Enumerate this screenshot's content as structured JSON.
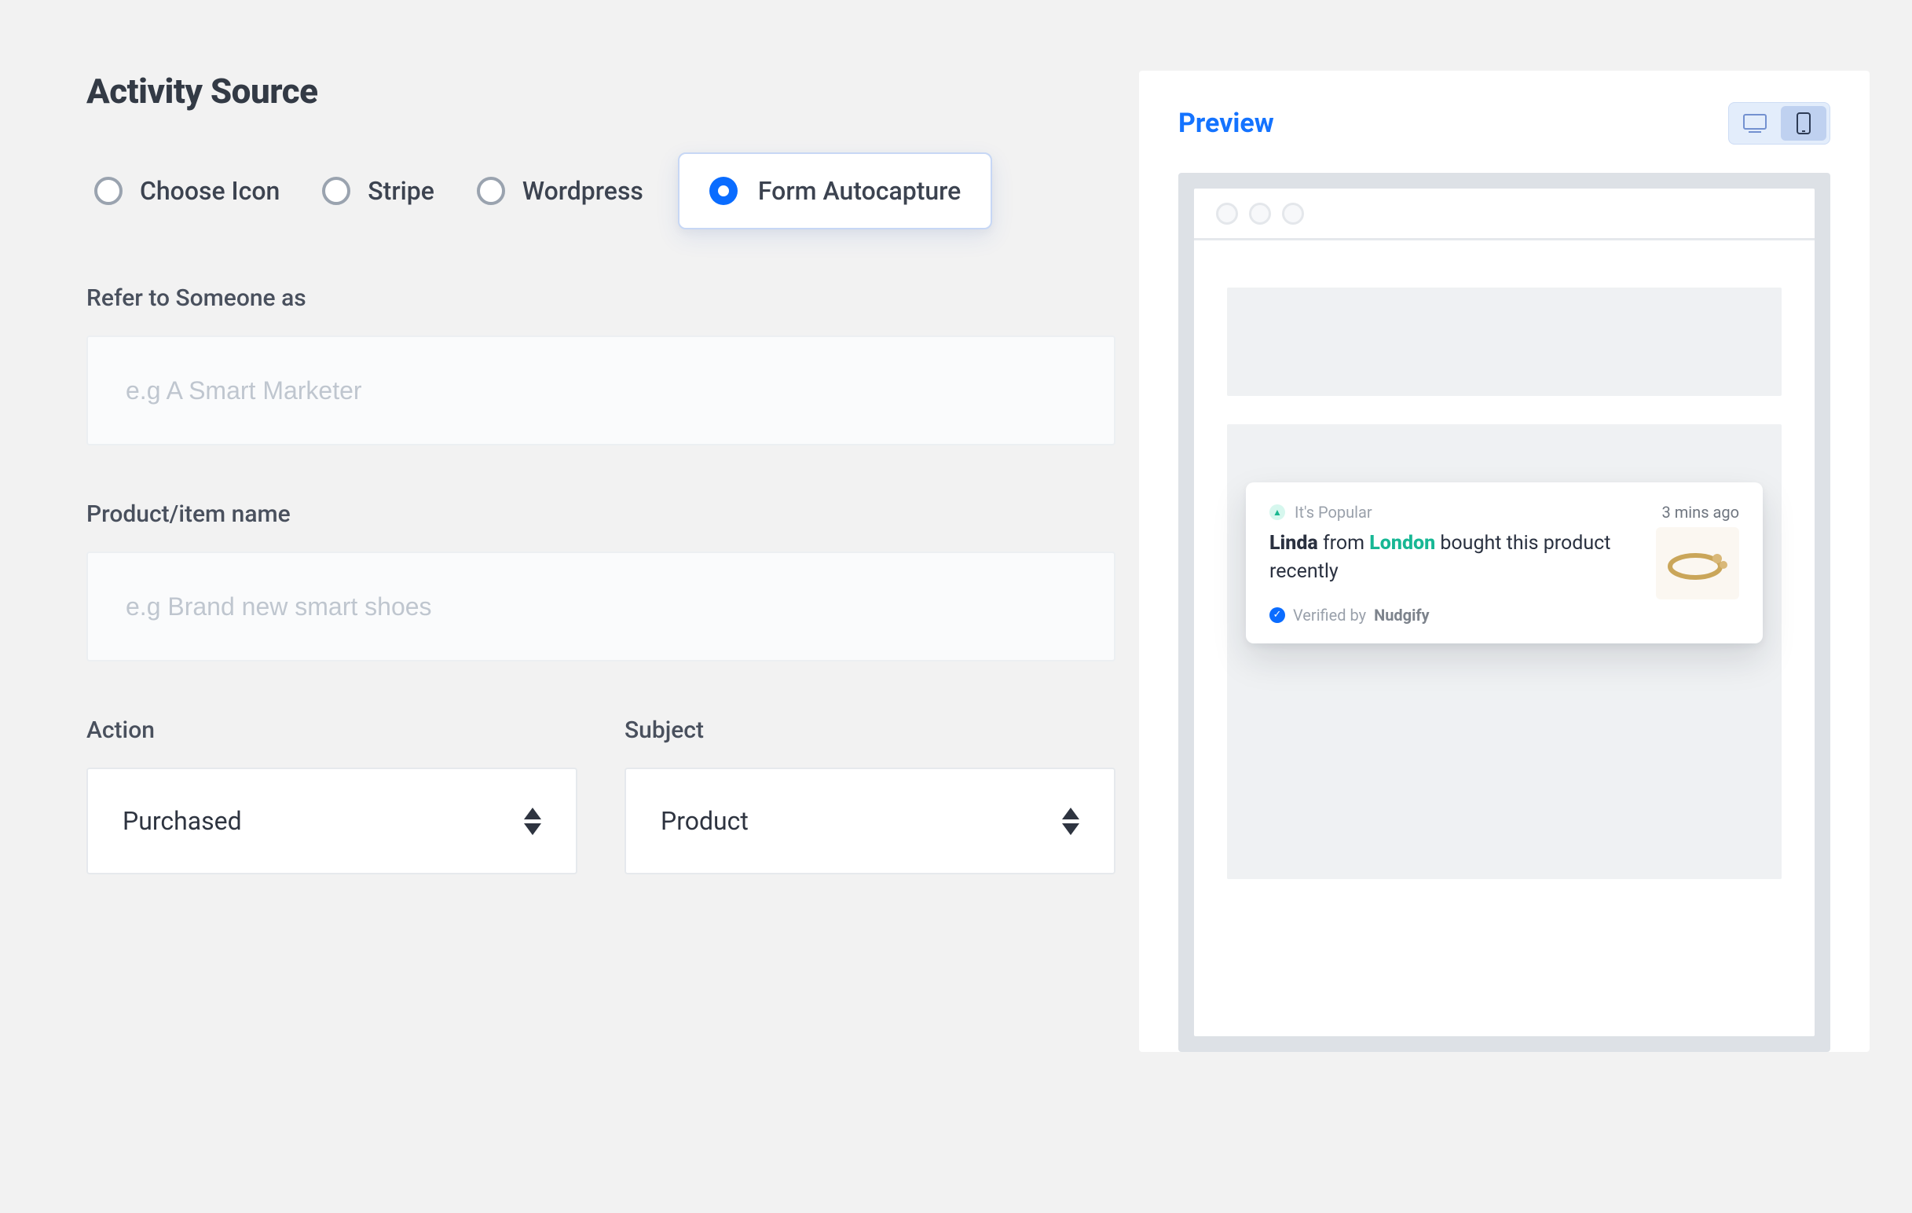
{
  "heading": "Activity Source",
  "sources": {
    "choose_icon": "Choose Icon",
    "stripe": "Stripe",
    "wordpress": "Wordpress",
    "form_autocapture": "Form Autocapture",
    "selected": "form_autocapture"
  },
  "refer_label": "Refer to Someone as",
  "refer_placeholder": "e.g A Smart Marketer",
  "product_label": "Product/item name",
  "product_placeholder": "e.g Brand new smart shoes",
  "action": {
    "label": "Action",
    "value": "Purchased"
  },
  "subject": {
    "label": "Subject",
    "value": "Product"
  },
  "preview": {
    "title": "Preview",
    "device": "mobile",
    "notif": {
      "tag": "It's Popular",
      "time": "3 mins ago",
      "person": "Linda",
      "from_word": "from",
      "city": "London",
      "rest": "bought this product recently",
      "verified_prefix": "Verified by",
      "verified_brand": "Nudgify"
    }
  }
}
